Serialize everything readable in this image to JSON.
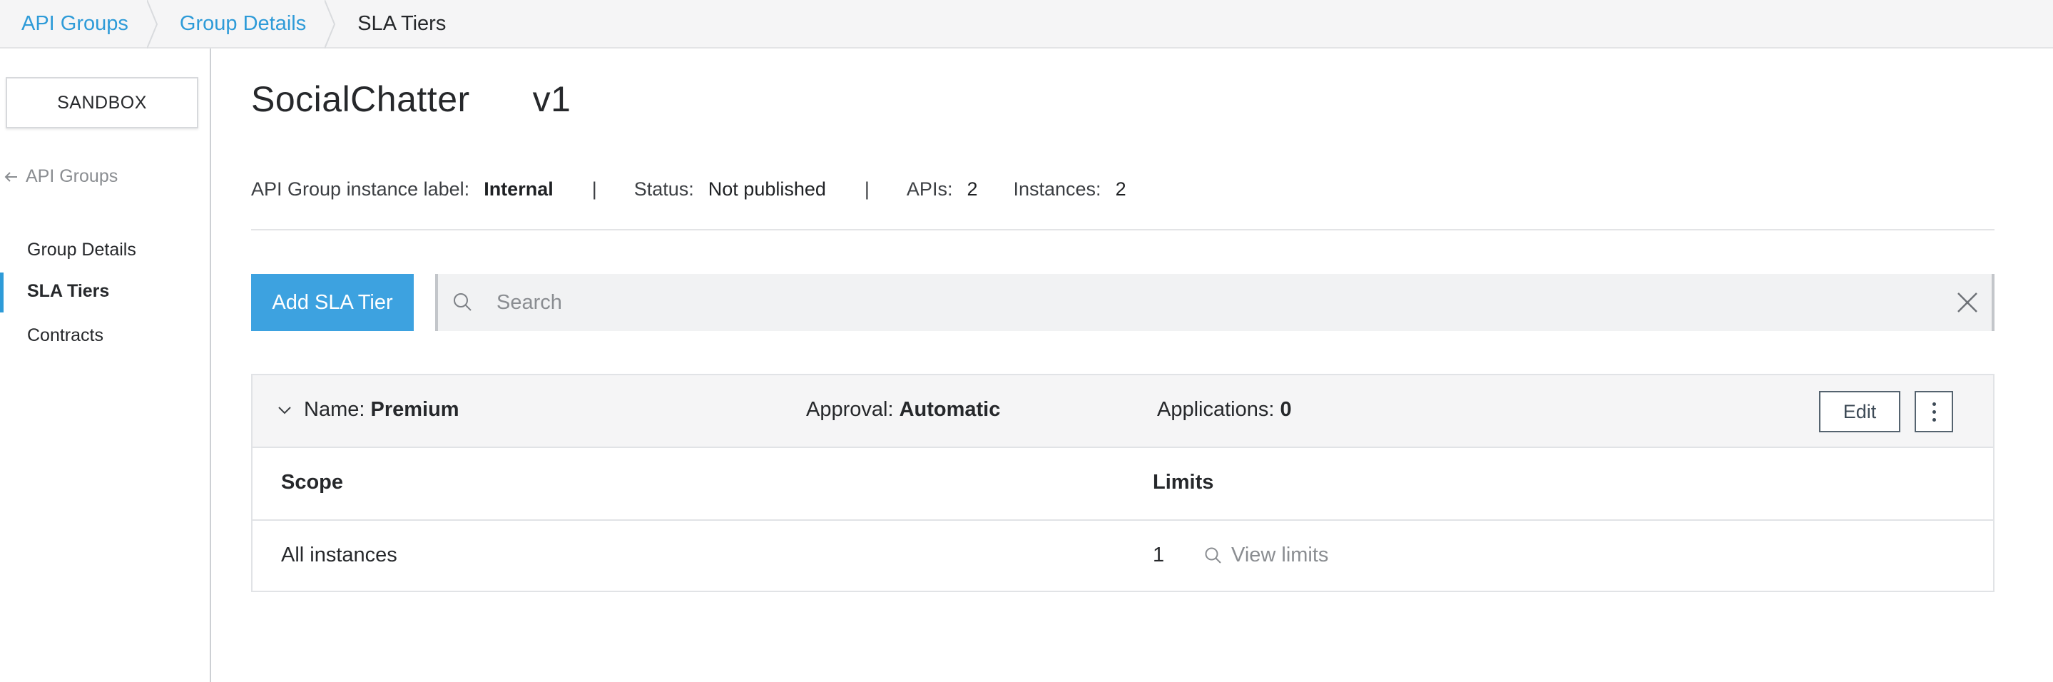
{
  "breadcrumb": {
    "items": [
      "API Groups",
      "Group Details",
      "SLA Tiers"
    ]
  },
  "sidebar": {
    "environment_button": "SANDBOX",
    "back_link": "API Groups",
    "items": [
      {
        "label": "Group Details",
        "active": false
      },
      {
        "label": "SLA Tiers",
        "active": true
      },
      {
        "label": "Contracts",
        "active": false
      }
    ]
  },
  "header": {
    "name": "SocialChatter",
    "version": "v1"
  },
  "meta": {
    "instance_label_key": "API Group instance label:",
    "instance_label_value": "Internal",
    "status_key": "Status:",
    "status_value": "Not published",
    "apis_key": "APIs:",
    "apis_value": "2",
    "instances_key": "Instances:",
    "instances_value": "2",
    "separator": "|"
  },
  "toolbar": {
    "add_button": "Add SLA Tier",
    "search_placeholder": "Search"
  },
  "tier": {
    "name_key": "Name:",
    "name_value": "Premium",
    "approval_key": "Approval:",
    "approval_value": "Automatic",
    "applications_key": "Applications:",
    "applications_value": "0",
    "edit_label": "Edit",
    "columns": [
      "Scope",
      "Limits"
    ],
    "rows": [
      {
        "scope": "All instances",
        "limits": "1",
        "view_limits": "View limits"
      }
    ]
  },
  "colors": {
    "accent": "#3da2e0",
    "link": "#2e9bd8",
    "muted": "#8a8d91"
  },
  "icons": [
    "arrow-left-icon",
    "search-icon",
    "close-icon",
    "chevron-down-icon",
    "kebab-menu-icon"
  ]
}
